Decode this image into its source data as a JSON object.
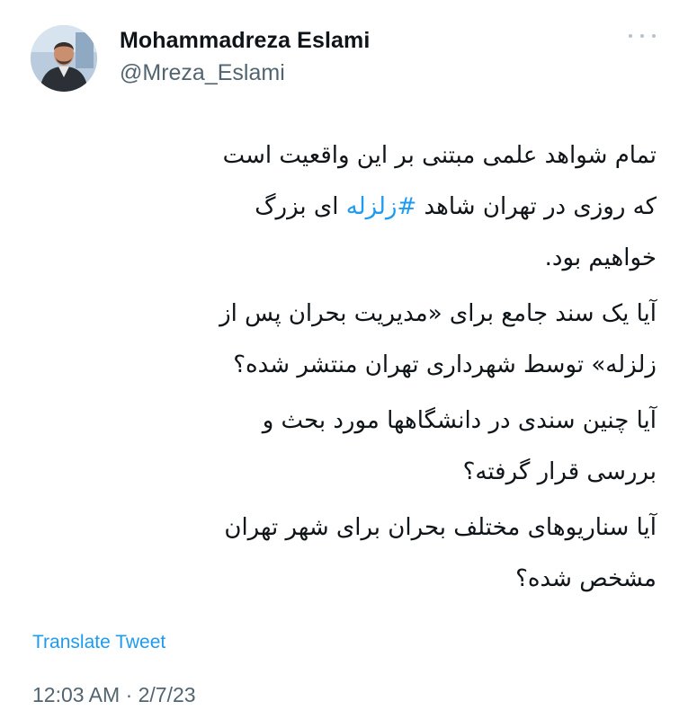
{
  "author": {
    "name": "Mohammadreza Eslami",
    "handle": "@Mreza_Eslami"
  },
  "tweet": {
    "line_1": "تمام شواهد علمی مبتنی بر این واقعیت است",
    "line_2_start": "که روزی در تهران شاهد ",
    "hashtag": "#زلزله",
    "line_2_end": " ای بزرگ",
    "line_3": "خواهیم بود.",
    "line_4": "آیا یک سند جامع برای «مدیریت بحران پس از",
    "line_5": "زلزله» توسط شهرداری تهران منتشر شده؟",
    "line_6": "آیا چنین سندی در دانشگاهها مورد بحث و",
    "line_7": "بررسی قرار گرفته؟",
    "line_8": "آیا سناریوهای مختلف بحران برای شهر تهران",
    "line_9": "مشخص شده؟"
  },
  "translate_label": "Translate Tweet",
  "timestamp": "12:03 AM · 2/7/23",
  "colors": {
    "link": "#1d9bf0",
    "secondary_text": "#536471"
  },
  "icons": {
    "more": "more-options-icon",
    "avatar": "profile-photo"
  }
}
